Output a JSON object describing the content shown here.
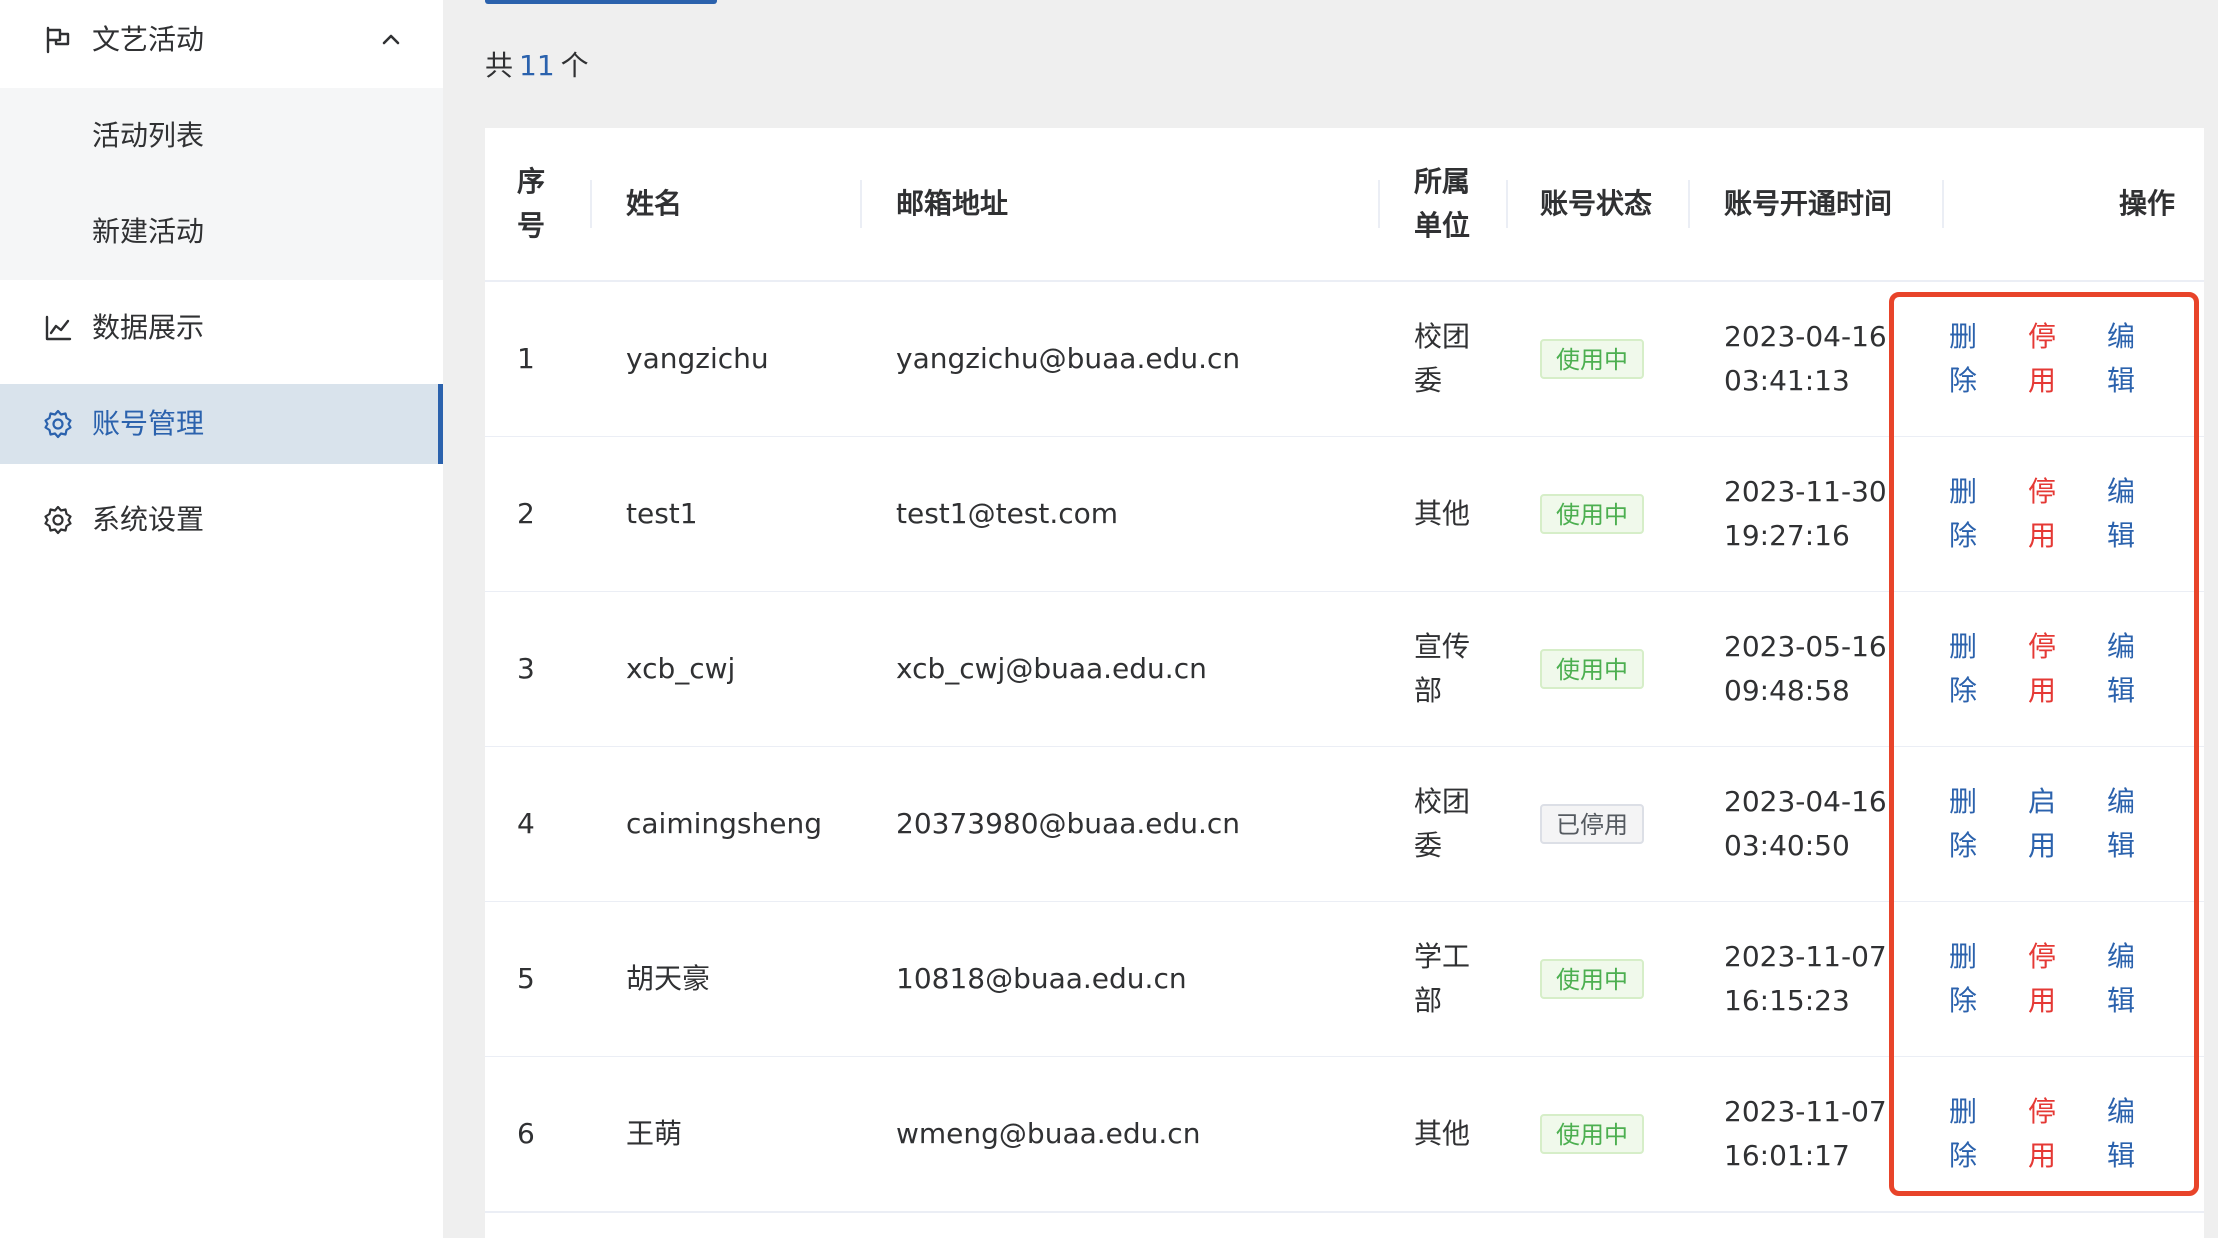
{
  "sidebar": {
    "activities_menu": {
      "label": "文艺活动",
      "icon": "flag-icon",
      "expanded": true
    },
    "activity_list": "活动列表",
    "new_activity": "新建活动",
    "data_display": {
      "label": "数据展示",
      "icon": "line-chart-icon"
    },
    "account_management": {
      "label": "账号管理",
      "icon": "gear-icon",
      "active": true
    },
    "system_settings": {
      "label": "系统设置",
      "icon": "gear-icon"
    }
  },
  "summary": {
    "prefix": "共",
    "count": "11",
    "suffix": "个"
  },
  "table": {
    "headers": {
      "index": "序号",
      "name": "姓名",
      "email": "邮箱地址",
      "unit": "所属单位",
      "status": "账号状态",
      "opened_time": "账号开通时间",
      "actions": "操作"
    },
    "rows": [
      {
        "index": "1",
        "name": "yangzichu",
        "email": "yangzichu@buaa.edu.cn",
        "unit": "校团委",
        "status": "使用中",
        "date": "2023-04-16",
        "time": "03:41:13",
        "delete": "删除",
        "toggle": "停用",
        "edit": "编辑"
      },
      {
        "index": "2",
        "name": "test1",
        "email": "test1@test.com",
        "unit": "其他",
        "status": "使用中",
        "date": "2023-11-30",
        "time": "19:27:16",
        "delete": "删除",
        "toggle": "停用",
        "edit": "编辑"
      },
      {
        "index": "3",
        "name": "xcb_cwj",
        "email": "xcb_cwj@buaa.edu.cn",
        "unit": "宣传部",
        "status": "使用中",
        "date": "2023-05-16",
        "time": "09:48:58",
        "delete": "删除",
        "toggle": "停用",
        "edit": "编辑"
      },
      {
        "index": "4",
        "name": "caimingsheng",
        "email": "20373980@buaa.edu.cn",
        "unit": "校团委",
        "status": "已停用",
        "date": "2023-04-16",
        "time": "03:40:50",
        "delete": "删除",
        "toggle": "启用",
        "edit": "编辑"
      },
      {
        "index": "5",
        "name": "胡天豪",
        "email": "10818@buaa.edu.cn",
        "unit": "学工部",
        "status": "使用中",
        "date": "2023-11-07",
        "time": "16:15:23",
        "delete": "删除",
        "toggle": "停用",
        "edit": "编辑"
      },
      {
        "index": "6",
        "name": "王萌",
        "email": "wmeng@buaa.edu.cn",
        "unit": "其他",
        "status": "使用中",
        "date": "2023-11-07",
        "time": "16:01:17",
        "delete": "删除",
        "toggle": "停用",
        "edit": "编辑"
      }
    ]
  },
  "colors": {
    "primary": "#2b62ad",
    "danger": "#e53935",
    "success": "#4caf50",
    "highlight_border": "#e8442a"
  }
}
